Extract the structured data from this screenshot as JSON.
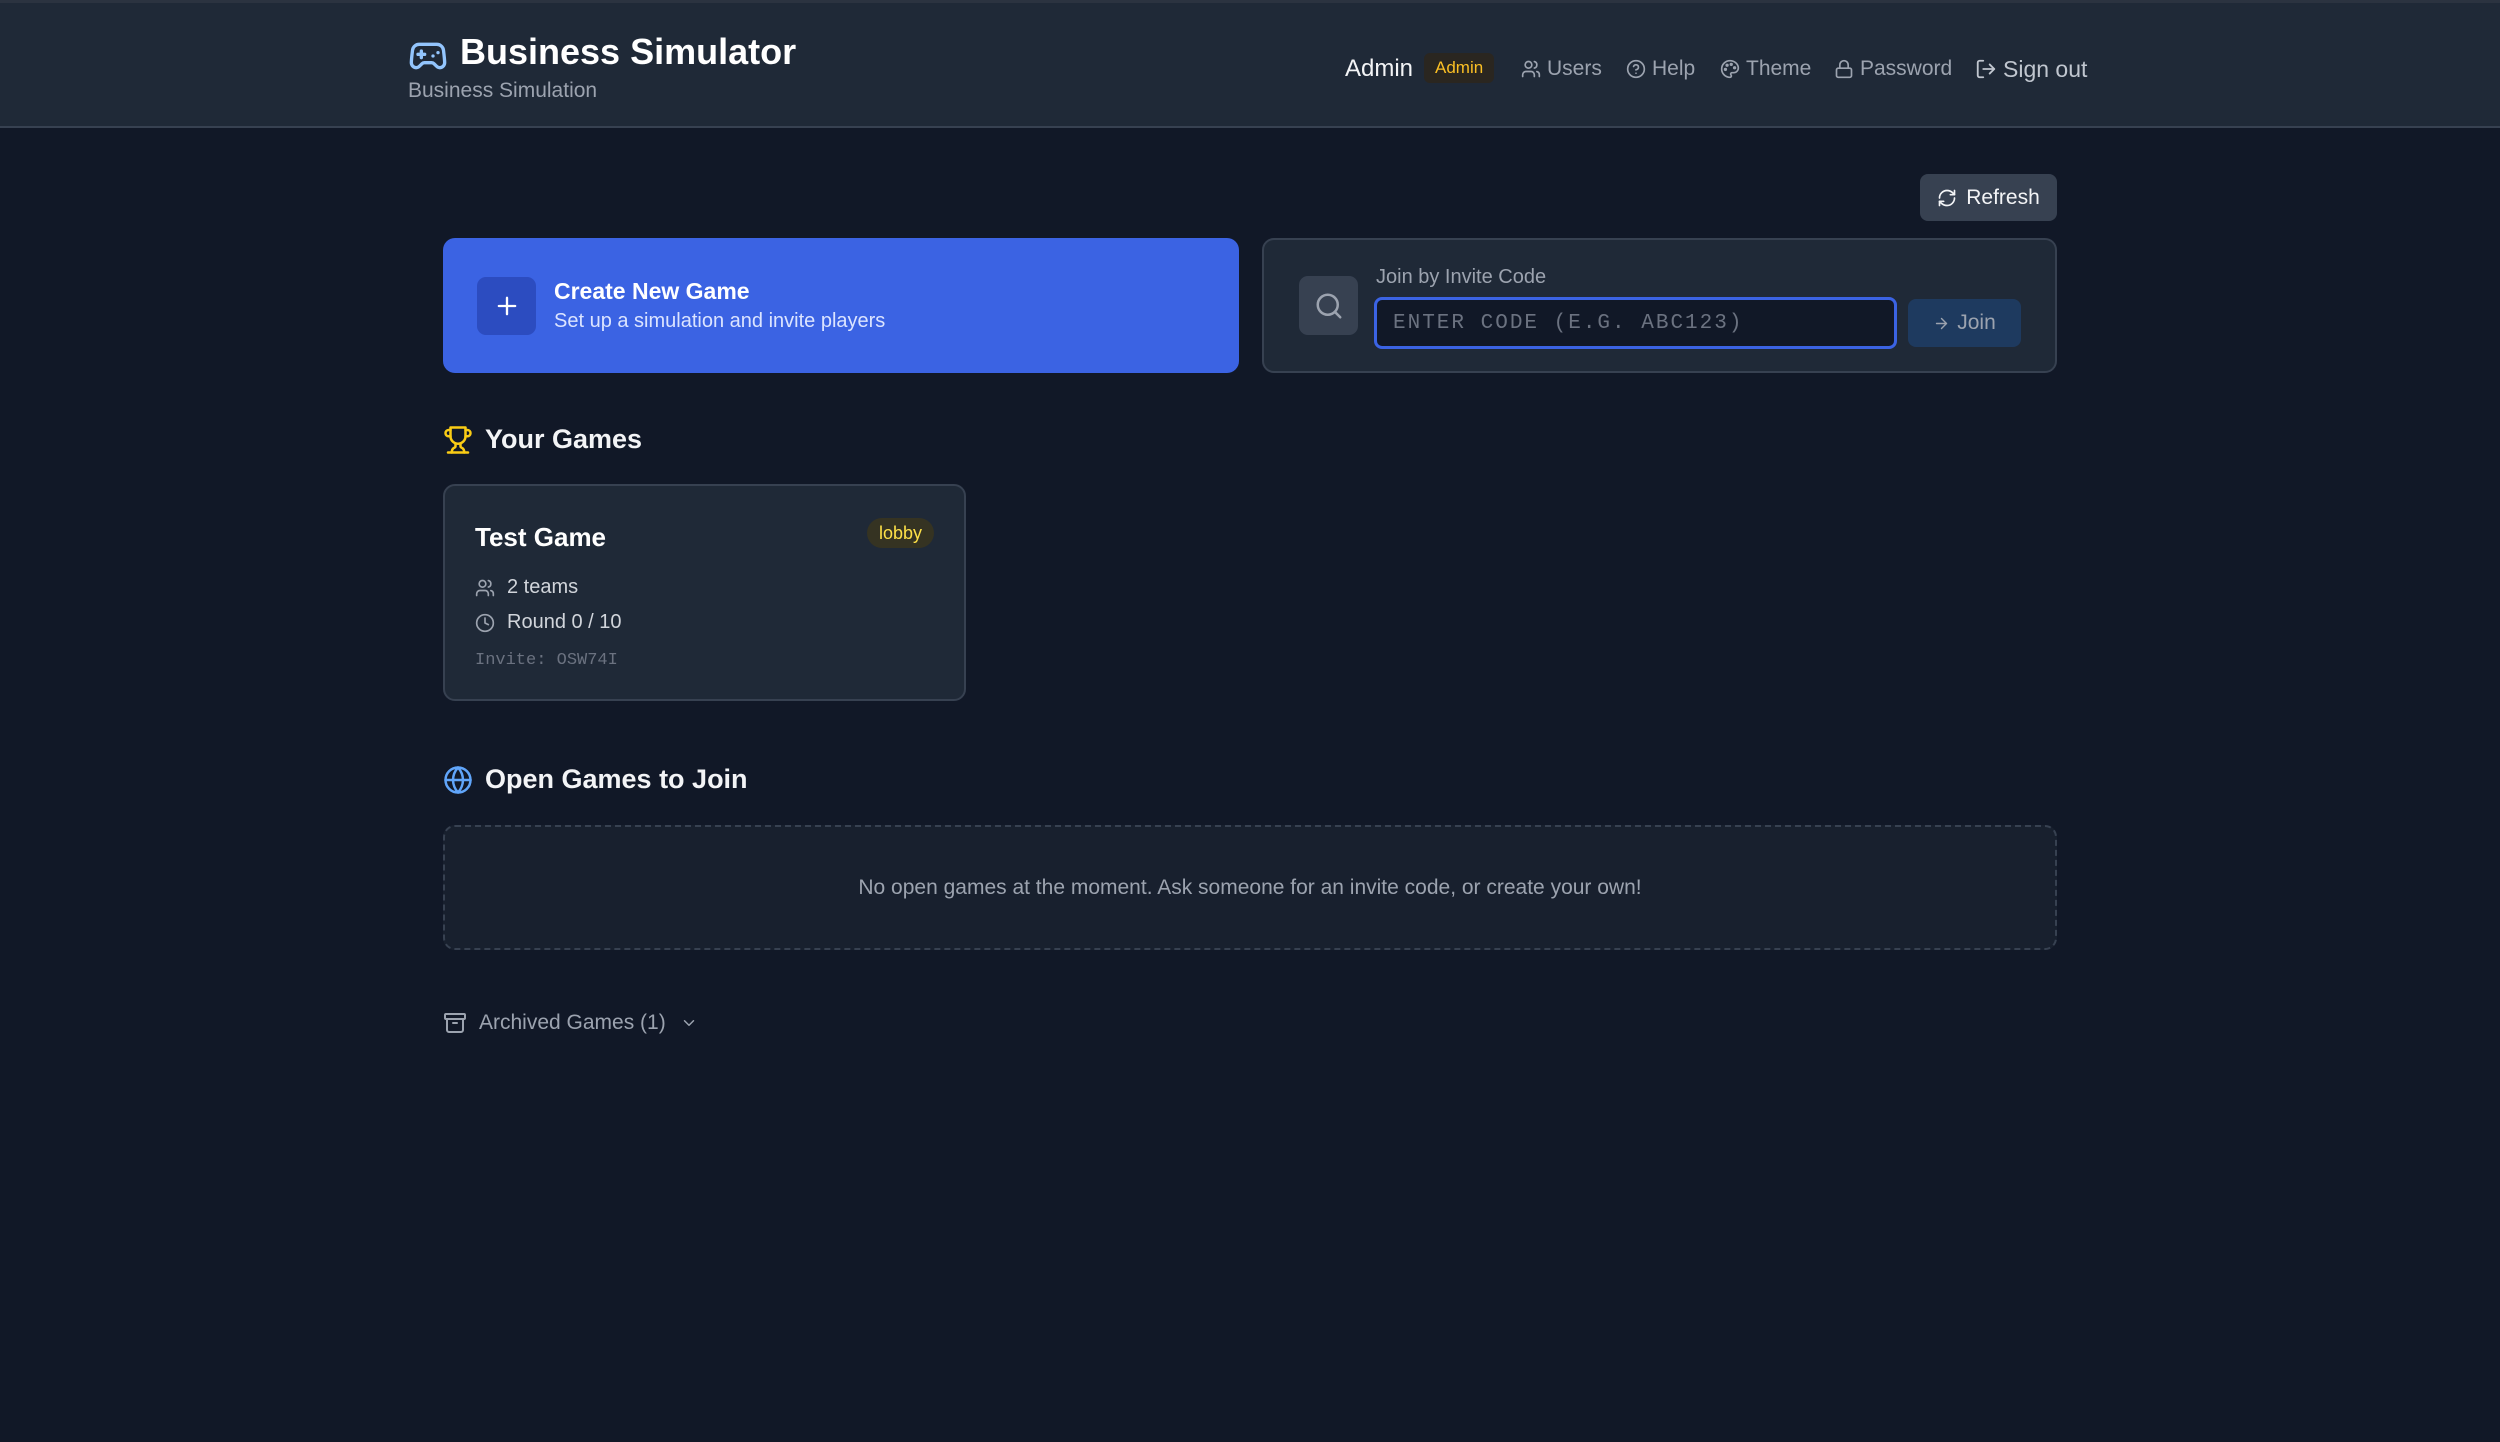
{
  "header": {
    "title": "Business Simulator",
    "subtitle": "Business Simulation",
    "brand_icon": "gamepad-icon",
    "user_name": "Admin",
    "role_badge": "Admin",
    "nav": {
      "users": "Users",
      "help": "Help",
      "theme": "Theme",
      "password": "Password",
      "sign_out": "Sign out"
    }
  },
  "toolbar": {
    "refresh_label": "Refresh"
  },
  "create": {
    "title": "Create New Game",
    "subtitle": "Set up a simulation and invite players"
  },
  "join": {
    "label": "Join by Invite Code",
    "input_value": "",
    "placeholder": "Enter code (e.g. ABC123)",
    "button_label": "Join"
  },
  "your_games": {
    "heading": "Your Games",
    "games": [
      {
        "title": "Test Game",
        "status": "lobby",
        "teams": "2 teams",
        "round": "Round 0 / 10",
        "invite": "Invite: OSW74I"
      }
    ]
  },
  "open_games": {
    "heading": "Open Games to Join",
    "empty_message": "No open games at the moment. Ask someone for an invite code, or create your own!"
  },
  "archived": {
    "label": "Archived Games (1)"
  },
  "colors": {
    "background": "#111827",
    "header_bg": "#1f2937",
    "accent": "#3b63e3",
    "status_lobby": "#fde047",
    "role_badge": "#fbbf24",
    "trophy": "#facc15",
    "globe": "#60a5fa"
  }
}
